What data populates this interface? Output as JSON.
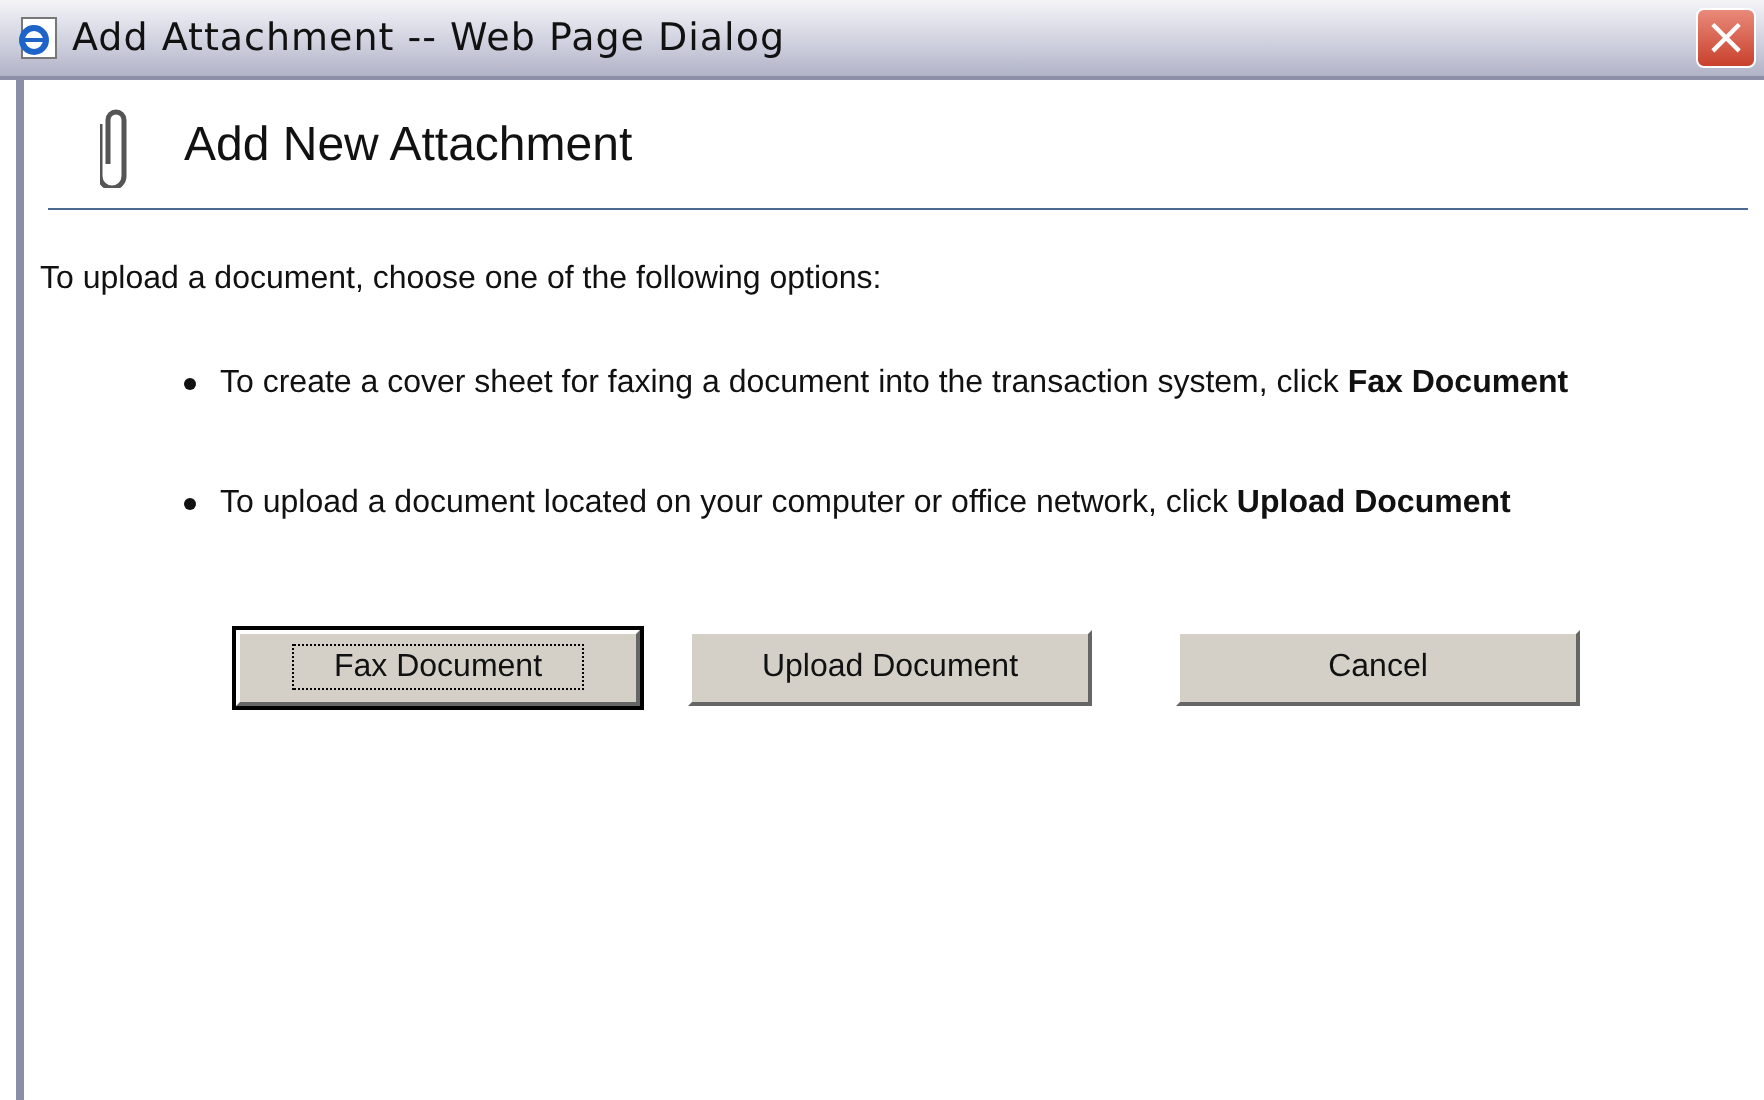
{
  "window": {
    "title": "Add Attachment -- Web Page Dialog",
    "close": "×"
  },
  "heading": "Add New Attachment",
  "intro": "To upload a document, choose one of the following options:",
  "bullets": [
    "To create a cover sheet for faxing a document into the transaction system, click **Fax Document**",
    "To upload a document located on your computer or office network, click **Upload Document**"
  ],
  "buttons": [
    {
      "label": "Fax Document",
      "focused": true
    },
    {
      "label": "Upload Document",
      "focused": false
    },
    {
      "label": "Cancel",
      "focused": false
    }
  ]
}
